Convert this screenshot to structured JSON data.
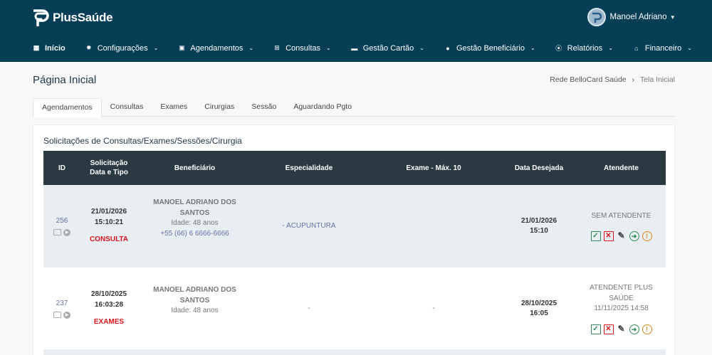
{
  "brand": {
    "name": "PlusSaúde"
  },
  "user": {
    "name": "Manoel Adriano"
  },
  "nav": [
    {
      "label": "Início",
      "icon": "grid-icon"
    },
    {
      "label": "Configurações",
      "icon": "gear-icon"
    },
    {
      "label": "Agendamentos",
      "icon": "calendar-icon"
    },
    {
      "label": "Consultas",
      "icon": "plus-square-icon"
    },
    {
      "label": "Gestão Cartão",
      "icon": "card-icon"
    },
    {
      "label": "Gestão Beneficiário",
      "icon": "user-icon"
    },
    {
      "label": "Relatórios",
      "icon": "paperclip-icon"
    },
    {
      "label": "Financeiro",
      "icon": "bank-icon"
    }
  ],
  "page": {
    "title": "Página Inicial"
  },
  "breadcrumb": {
    "root": "Rede BelloCard Saúde",
    "current": "Tela Inicial"
  },
  "tabs": [
    "Agendamentos",
    "Consultas",
    "Exames",
    "Cirurgias",
    "Sessão",
    "Aguardando Pgto"
  ],
  "card": {
    "title": "Solicitações de Consultas/Exames/Sessões/Cirurgia"
  },
  "table": {
    "headers": {
      "id": "ID",
      "solicitacao1": "Solicitação",
      "solicitacao2": "Data e Tipo",
      "beneficiario": "Beneficiário",
      "especialidade": "Especialidade",
      "exame": "Exame - Máx. 10",
      "data_desejada": "Data Desejada",
      "atendente": "Atendente"
    },
    "rows": [
      {
        "id": "256",
        "date": "21/01/2026",
        "time": "15:10:21",
        "type": "CONSULTA",
        "beneficiary_line1": "MANOEL ADRIANO DOS",
        "beneficiary_line2": "SANTOS",
        "age": "Idade: 48 anos",
        "phone": "+55 (66) 6 6666-6666",
        "specialty": "- ACUPUNTURA",
        "exam": "",
        "desired_date": "21/01/2026",
        "desired_time": "15:10",
        "attendant_line1": "SEM ATENDENTE",
        "attendant_line2": "",
        "attendant_date": ""
      },
      {
        "id": "237",
        "date": "28/10/2025",
        "time": "16:03:28",
        "type": "EXAMES",
        "beneficiary_line1": "MANOEL ADRIANO DOS",
        "beneficiary_line2": "SANTOS",
        "age": "Idade: 48 anos",
        "phone": "",
        "specialty": "-",
        "exam": "-",
        "desired_date": "28/10/2025",
        "desired_time": "16:05",
        "attendant_line1": "ATENDENTE PLUS",
        "attendant_line2": "SAÚDE",
        "attendant_date": "11/11/2025 14:58"
      }
    ]
  },
  "colors": {
    "topbar": "#053e55",
    "header": "#2b3a42",
    "accent": "#6671a8",
    "danger": "#d9161c",
    "success": "#2e8b57",
    "warning": "#d9871a"
  }
}
